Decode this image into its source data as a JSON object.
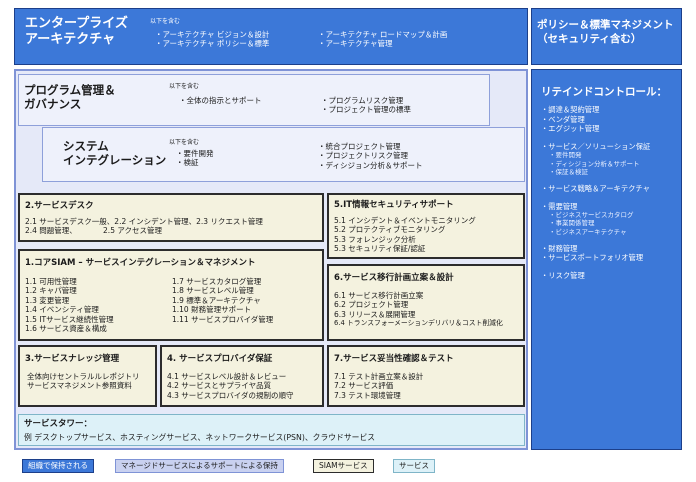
{
  "enterprise": {
    "title": [
      "エンタープライズ",
      "アーキテクチャ"
    ],
    "includes_label": "以下を含む",
    "items_col1": [
      "・アーキテクチャ ビジョン＆設計",
      "・アーキテクチャ ポリシー＆標準"
    ],
    "items_col2": [
      "・アーキテクチャ ロードマップ＆計画",
      "・アーキテクチャ管理"
    ]
  },
  "policy": {
    "title": [
      "ポリシー＆標準マネジメント",
      "（セキュリティ含む）"
    ]
  },
  "retained": {
    "title": "リテインドコントロール：",
    "groups": [
      {
        "items": [
          "・調達＆契約管理",
          "・ベンダ管理",
          "・エグジット管理"
        ],
        "subs": []
      },
      {
        "items": [
          "・サービス／ソリューション保証"
        ],
        "subs": [
          "・要件開発",
          "・ディシジョン分析＆サポート",
          "・保証＆検証"
        ]
      },
      {
        "items": [
          "・サービス戦略＆アーキテクチャ"
        ],
        "subs": []
      },
      {
        "items": [
          "・需要管理"
        ],
        "subs": [
          "・ビジネスサービスカタログ",
          "・事業関係管理",
          "・ビジネスアーキテクチャ"
        ]
      },
      {
        "items": [
          "・財務管理",
          "・サービスポートフォリオ管理"
        ],
        "subs": []
      },
      {
        "items": [
          "・リスク管理"
        ],
        "subs": []
      }
    ]
  },
  "program": {
    "title": [
      "プログラム管理＆",
      "ガバナンス"
    ],
    "includes_label": "以下を含む",
    "item_left": "・全体の指示とサポート",
    "items_right": [
      "・プログラムリスク管理",
      "・プロジェクト管理の標準"
    ]
  },
  "sysint": {
    "title": [
      "システム",
      "インテグレーション"
    ],
    "includes_label": "以下を含む",
    "items_left": [
      "・要件開発",
      "・検証"
    ],
    "items_right": [
      "・統合プロジェクト管理",
      "・プロジェクトリスク管理",
      "・ディシジョン分析＆サポート"
    ]
  },
  "service_desk": {
    "title": "2.サービスデスク",
    "lines": [
      "2.1 サービスデスク一般、2.2 インシデント管理、2.3 リクエスト管理",
      "2.4 問題管理、           2.5 アクセス管理"
    ]
  },
  "it_security": {
    "title": "5.IT情報セキュリティサポート",
    "items": [
      "5.1 インシデント＆イベントモニタリング",
      "5.2 プロテクティブモニタリング",
      "5.3 フォレンジック分析",
      "5.3 セキュリティ保証/認証"
    ]
  },
  "core_siam": {
    "title": "1.コアSIAM – サービスインテグレーション＆マネジメント",
    "left": [
      "1.1 可用性管理",
      "1.2 キャパ管理",
      "1.3 変更管理",
      "1.4 イベンシティ管理",
      "1.5 ITサービス継続性管理",
      "1.6 サービス資産＆構成"
    ],
    "right": [
      "1.7 サービスカタログ管理",
      "1.8 サービスレベル管理",
      "1.9 標準＆アーキテクチャ",
      "1.10 財務管理サポート",
      "1.11 サービスプロバイダ管理"
    ]
  },
  "transition": {
    "title": "6.サービス移行計画立案＆設計",
    "items": [
      "6.1 サービス移行計画立案",
      "6.2 プロジェクト管理",
      "6.3 リリース＆展開管理",
      "6.4 トランスフォーメーションデリバリ＆コスト削減化"
    ]
  },
  "knowledge": {
    "title": "3.サービスナレッジ管理",
    "items": [
      "全体向けセントラルルレポジトリ",
      "サービスマネジメント参照資料"
    ]
  },
  "provider": {
    "title": "4. サービスプロバイダ保証",
    "items": [
      "4.1 サービスレベル設計＆レビュー",
      "4.2 サービスとサプライヤ品質",
      "4.3 サービスプロバイダの規制の順守"
    ]
  },
  "validation": {
    "title": "7.サービス妥当性確認＆テスト",
    "items": [
      "7.1 テスト計画立案＆設計",
      "7.2 サービス評価",
      "7.3 テスト環境管理"
    ]
  },
  "towers": {
    "title": "サービスタワー：",
    "text": "例 デスクトップサービス、ホスティングサービス、ネットワークサービス(PSN)、クラウドサービス"
  },
  "legend": [
    {
      "label": "組織で保持される",
      "color": "#3c78d8"
    },
    {
      "label": "マネージドサービスによるサポートによる保持",
      "color": "#c9d1f0"
    },
    {
      "label": "SIAMサービス",
      "color": "#f4f2df"
    },
    {
      "label": "サービス",
      "color": "#ddf1f8"
    }
  ]
}
